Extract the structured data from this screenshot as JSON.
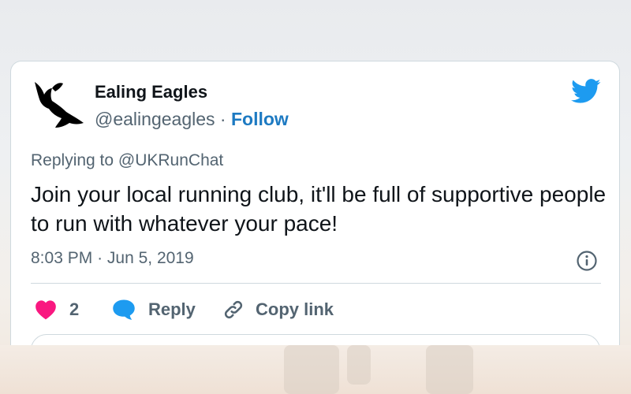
{
  "account": {
    "name": "Ealing Eagles",
    "handle": "@ealingeagles",
    "separator": "·",
    "follow_label": "Follow",
    "avatar_icon": "eagle-silhouette-icon",
    "platform_icon": "twitter-bird-icon"
  },
  "tweet": {
    "replying_to": "Replying to @UKRunChat",
    "text": "Join your local running club, it'll be full of supportive people to run with whatever your pace!",
    "time": "8:03 PM",
    "date_separator": "·",
    "date": "Jun 5, 2019",
    "info_icon": "info-icon"
  },
  "actions": {
    "like_count": "2",
    "like_icon": "heart-icon",
    "reply_label": "Reply",
    "reply_icon": "speech-bubble-icon",
    "copy_label": "Copy link",
    "copy_icon": "link-icon"
  },
  "colors": {
    "brand_blue": "#1d9bf0",
    "follow_blue": "#1d7ac2",
    "like_pink": "#f91880",
    "text_primary": "#0f1419",
    "text_secondary": "#536471"
  }
}
